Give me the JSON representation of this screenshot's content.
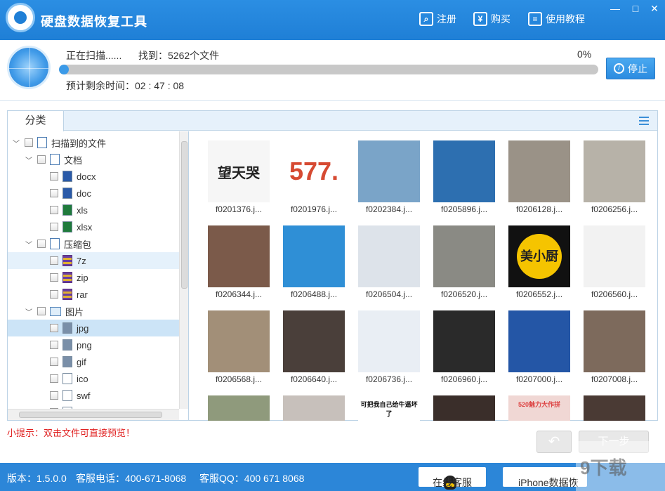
{
  "app": {
    "title": "硬盘数据恢复工具"
  },
  "titlebar": {
    "register": "注册",
    "register_icon": "search-icon",
    "buy": "购买",
    "buy_icon": "yen-icon",
    "tutorial": "使用教程",
    "tutorial_icon": "book-icon",
    "minimize": "—",
    "maximize": "□",
    "close": "✕"
  },
  "scan": {
    "status": "正在扫描......",
    "found": "找到：5262个文件",
    "percent": "0%",
    "progress": 0.0,
    "remaining": "预计剩余时间：02 : 47 : 08",
    "stop": "停止"
  },
  "panel": {
    "tab": "分类"
  },
  "tree": [
    {
      "label": "扫描到的文件",
      "level": 0,
      "expander": "﹀",
      "icon": "list"
    },
    {
      "label": "文档",
      "level": 1,
      "expander": "﹀",
      "icon": "folder"
    },
    {
      "label": "docx",
      "level": 2,
      "icon": "word"
    },
    {
      "label": "doc",
      "level": 2,
      "icon": "word"
    },
    {
      "label": "xls",
      "level": 2,
      "icon": "excel"
    },
    {
      "label": "xlsx",
      "level": 2,
      "icon": "excel"
    },
    {
      "label": "压缩包",
      "level": 1,
      "expander": "﹀",
      "icon": "folder"
    },
    {
      "label": "7z",
      "level": 2,
      "icon": "zip"
    },
    {
      "label": "zip",
      "level": 2,
      "icon": "zip"
    },
    {
      "label": "rar",
      "level": 2,
      "icon": "zip"
    },
    {
      "label": "图片",
      "level": 1,
      "expander": "﹀",
      "icon": "img"
    },
    {
      "label": "jpg",
      "level": 2,
      "icon": "pic",
      "selected": true
    },
    {
      "label": "png",
      "level": 2,
      "icon": "pic"
    },
    {
      "label": "gif",
      "level": 2,
      "icon": "pic"
    },
    {
      "label": "ico",
      "level": 2,
      "icon": "file"
    },
    {
      "label": "swf",
      "level": 2,
      "icon": "file"
    },
    {
      "label": "b",
      "level": 2,
      "icon": "file"
    }
  ],
  "files": [
    {
      "name": "f0201376.j...",
      "bg": "#f6f6f6",
      "text": "望天哭",
      "text_color": "#222"
    },
    {
      "name": "f0201976.j...",
      "bg": "#ffffff",
      "text": "577.",
      "text_color": "#d64a32"
    },
    {
      "name": "f0202384.j...",
      "bg": "#7aa4c8",
      "text": ""
    },
    {
      "name": "f0205896.j...",
      "bg": "#2d6fb0",
      "text": ""
    },
    {
      "name": "f0206128.j...",
      "bg": "#9a9287",
      "text": ""
    },
    {
      "name": "f0206256.j...",
      "bg": "#b7b2a8",
      "text": ""
    },
    {
      "name": "f0206344.j...",
      "bg": "#7b5a4a",
      "text": ""
    },
    {
      "name": "f0206488.j...",
      "bg": "#2f8fd6",
      "text": ""
    },
    {
      "name": "f0206504.j...",
      "bg": "#dde3ea",
      "text": ""
    },
    {
      "name": "f0206520.j...",
      "bg": "#8a8a84",
      "text": ""
    },
    {
      "name": "f0206552.j...",
      "bg": "#111111",
      "text": "美小厨",
      "text_color": "#222"
    },
    {
      "name": "f0206560.j...",
      "bg": "#f2f2f2",
      "text": ""
    },
    {
      "name": "f0206568.j...",
      "bg": "#a28f78",
      "text": ""
    },
    {
      "name": "f0206640.j...",
      "bg": "#4a3f3a",
      "text": ""
    },
    {
      "name": "f0206736.j...",
      "bg": "#e9eef4",
      "text": ""
    },
    {
      "name": "f0206960.j...",
      "bg": "#2a2a2a",
      "text": ""
    },
    {
      "name": "f0207000.j...",
      "bg": "#2456a6",
      "text": ""
    },
    {
      "name": "f0207008.j...",
      "bg": "#7d6a5c",
      "text": ""
    },
    {
      "name": "",
      "bg": "#8f9a7c",
      "text": ""
    },
    {
      "name": "",
      "bg": "#c7c0bb",
      "text": ""
    },
    {
      "name": "",
      "bg": "#ffffff",
      "text": "可把我自己给牛逼坏了",
      "text_color": "#111"
    },
    {
      "name": "",
      "bg": "#3a2e2a",
      "text": ""
    },
    {
      "name": "",
      "bg": "#f0d7d4",
      "text": "520魅力大作拼",
      "text_color": "#d44"
    },
    {
      "name": "",
      "bg": "#4a3a34",
      "text": ""
    }
  ],
  "tip": "小提示：双击文件可直接预览！",
  "nav": {
    "prev": "↶",
    "next": "下一步"
  },
  "status": {
    "version": "版本：1.5.0.0",
    "phone": "客服电话：400-671-8068",
    "qq": "客服QQ：400 671 8068",
    "service_btn": "在线客服",
    "iphone_btn": "iPhone数据恢复"
  },
  "watermark": "9下载"
}
